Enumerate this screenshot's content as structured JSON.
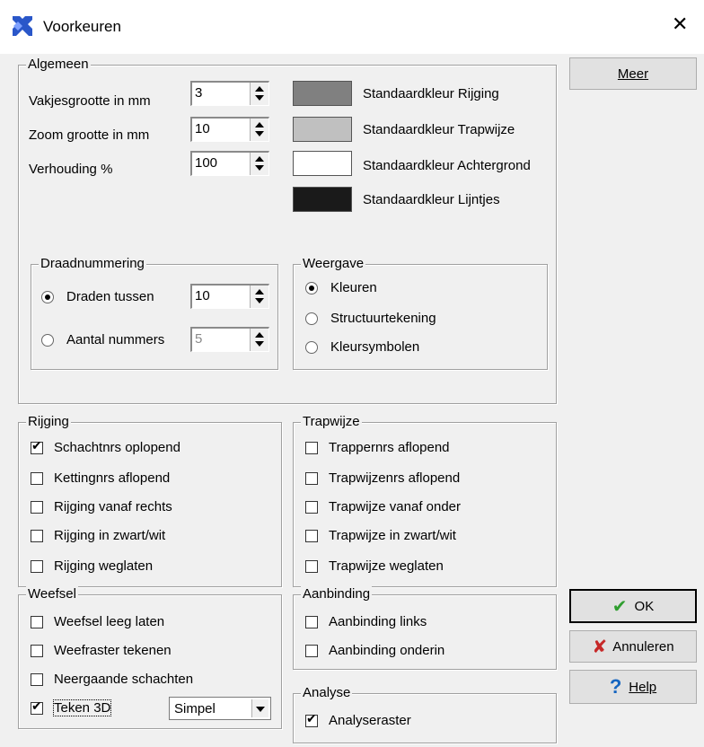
{
  "window": {
    "title": "Voorkeuren",
    "close_glyph": "✕"
  },
  "algemeen": {
    "legend": "Algemeen",
    "fields": [
      {
        "label": "Vakjesgrootte in mm",
        "value": "3"
      },
      {
        "label": "Zoom grootte in mm",
        "value": "10"
      },
      {
        "label": "Verhouding %",
        "value": "100"
      }
    ],
    "colors": [
      {
        "label": "Standaardkleur Rijging",
        "color": "#808080"
      },
      {
        "label": "Standaardkleur Trapwijze",
        "color": "#c0c0c0"
      },
      {
        "label": "Standaardkleur Achtergrond",
        "color": "#ffffff"
      },
      {
        "label": "Standaardkleur Lijntjes",
        "color": "#1a1a1a"
      }
    ],
    "draadnummering": {
      "legend": "Draadnummering",
      "options": [
        {
          "label": "Draden tussen",
          "value": "10",
          "checked": true
        },
        {
          "label": "Aantal nummers",
          "value": "5",
          "checked": false
        }
      ]
    },
    "weergave": {
      "legend": "Weergave",
      "options": [
        {
          "label": "Kleuren",
          "checked": true
        },
        {
          "label": "Structuurtekening",
          "checked": false
        },
        {
          "label": "Kleursymbolen",
          "checked": false
        }
      ]
    }
  },
  "rijging": {
    "legend": "Rijging",
    "items": [
      {
        "label": "Schachtnrs oplopend",
        "checked": true
      },
      {
        "label": "Kettingnrs aflopend",
        "checked": false
      },
      {
        "label": "Rijging vanaf rechts",
        "checked": false
      },
      {
        "label": "Rijging in zwart/wit",
        "checked": false
      },
      {
        "label": "Rijging weglaten",
        "checked": false
      }
    ]
  },
  "trapwijze": {
    "legend": "Trapwijze",
    "items": [
      {
        "label": "Trappernrs aflopend",
        "checked": false
      },
      {
        "label": "Trapwijzenrs aflopend",
        "checked": false
      },
      {
        "label": "Trapwijze vanaf onder",
        "checked": false
      },
      {
        "label": "Trapwijze in zwart/wit",
        "checked": false
      },
      {
        "label": "Trapwijze weglaten",
        "checked": false
      }
    ]
  },
  "weefsel": {
    "legend": "Weefsel",
    "items": [
      {
        "label": "Weefsel leeg laten",
        "checked": false
      },
      {
        "label": "Weefraster tekenen",
        "checked": false
      },
      {
        "label": "Neergaande schachten",
        "checked": false
      },
      {
        "label": "Teken 3D",
        "checked": true
      }
    ],
    "select_value": "Simpel"
  },
  "aanbinding": {
    "legend": "Aanbinding",
    "items": [
      {
        "label": "Aanbinding links",
        "checked": false
      },
      {
        "label": "Aanbinding onderin",
        "checked": false
      }
    ]
  },
  "analyse": {
    "legend": "Analyse",
    "items": [
      {
        "label": "Analyseraster",
        "checked": true
      }
    ]
  },
  "buttons": {
    "meer": "Meer",
    "ok": "OK",
    "annuleren": "Annuleren",
    "help": "Help"
  }
}
